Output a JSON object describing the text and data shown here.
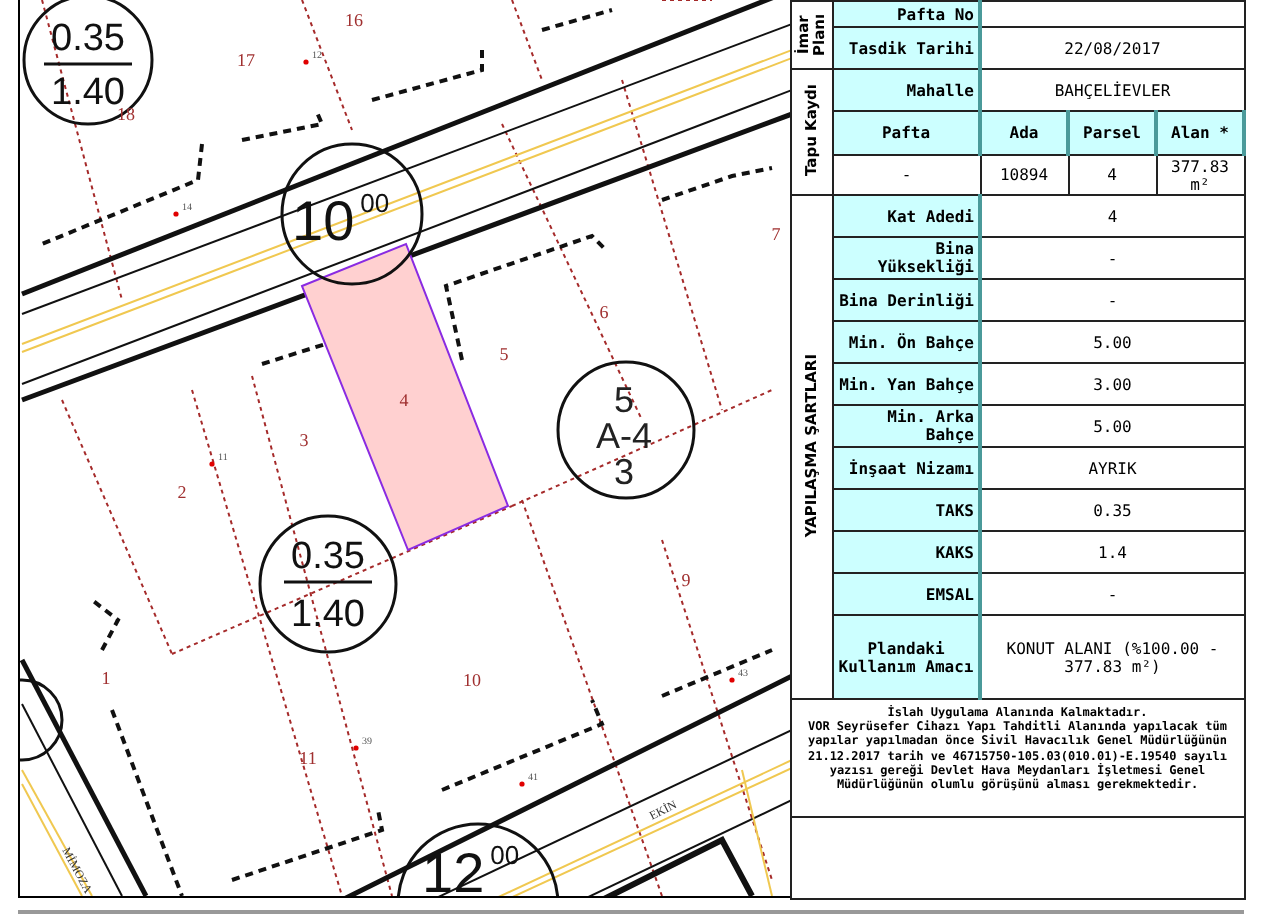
{
  "map": {
    "parcel_numbers": [
      "16",
      "17",
      "18",
      "6",
      "5",
      "4",
      "3",
      "7",
      "2",
      "9",
      "10",
      "11",
      "1"
    ],
    "point_numbers": [
      "12",
      "14",
      "11",
      "39",
      "41",
      "43"
    ],
    "road_widths": [
      {
        "whole": "10",
        "fraction": "00"
      },
      {
        "whole": "12",
        "fraction": "00"
      }
    ],
    "density_labels": [
      {
        "taks": "0.35",
        "kaks": "1.40"
      },
      {
        "taks": "0.35",
        "kaks": "1.40"
      }
    ],
    "block_label": {
      "number": "5",
      "sheet": "A-4",
      "parcel": "3"
    },
    "street_names": [
      "MİMOZA",
      "EKİN"
    ]
  },
  "imar_plani": {
    "side_label": "İmar Planı",
    "rows": [
      {
        "label": "Pafta No"
      },
      {
        "label": "Tasdik Tarihi",
        "value": "22/08/2017"
      }
    ]
  },
  "tapu_kaydi": {
    "side_label": "Tapu Kaydı",
    "mahalle_label": "Mahalle",
    "mahalle": "BAHÇELİEVLER",
    "columns": [
      "Pafta",
      "Ada",
      "Parsel",
      "Alan *"
    ],
    "values": [
      "-",
      "10894",
      "4",
      "377.83 m²"
    ]
  },
  "yapilasma_sartlari": {
    "side_label": "YAPILAŞMA ŞARTLARI",
    "rows": [
      {
        "label": "Kat Adedi",
        "value": "4"
      },
      {
        "label": "Bina Yüksekliği",
        "value": "-"
      },
      {
        "label": "Bina Derinliği",
        "value": "-"
      },
      {
        "label": "Min. Ön Bahçe",
        "value": "5.00"
      },
      {
        "label": "Min. Yan Bahçe",
        "value": "3.00"
      },
      {
        "label": "Min. Arka Bahçe",
        "value": "5.00"
      },
      {
        "label": "İnşaat Nizamı",
        "value": "AYRIK"
      },
      {
        "label": "TAKS",
        "value": "0.35"
      },
      {
        "label": "KAKS",
        "value": "1.4"
      },
      {
        "label": "EMSAL",
        "value": "-"
      },
      {
        "label": "Plandaki Kullanım Amacı",
        "value": "KONUT ALANI (%100.00 - 377.83 m²)"
      }
    ]
  },
  "notes": [
    "İslah Uygulama Alanında Kalmaktadır.",
    "VOR Seyrüsefer Cihazı Yapı Tahditli Alanında yapılacak tüm yapılar yapılmadan önce Sivil Havacılık Genel Müdürlüğünün 21.12.2017 tarih ve 46715750-105.03(010.01)-E.19540 sayılı yazısı gereği Devlet Hava Meydanları İşletmesi Genel Müdürlüğünün olumlu görüşünü alması gerekmektedir."
  ]
}
